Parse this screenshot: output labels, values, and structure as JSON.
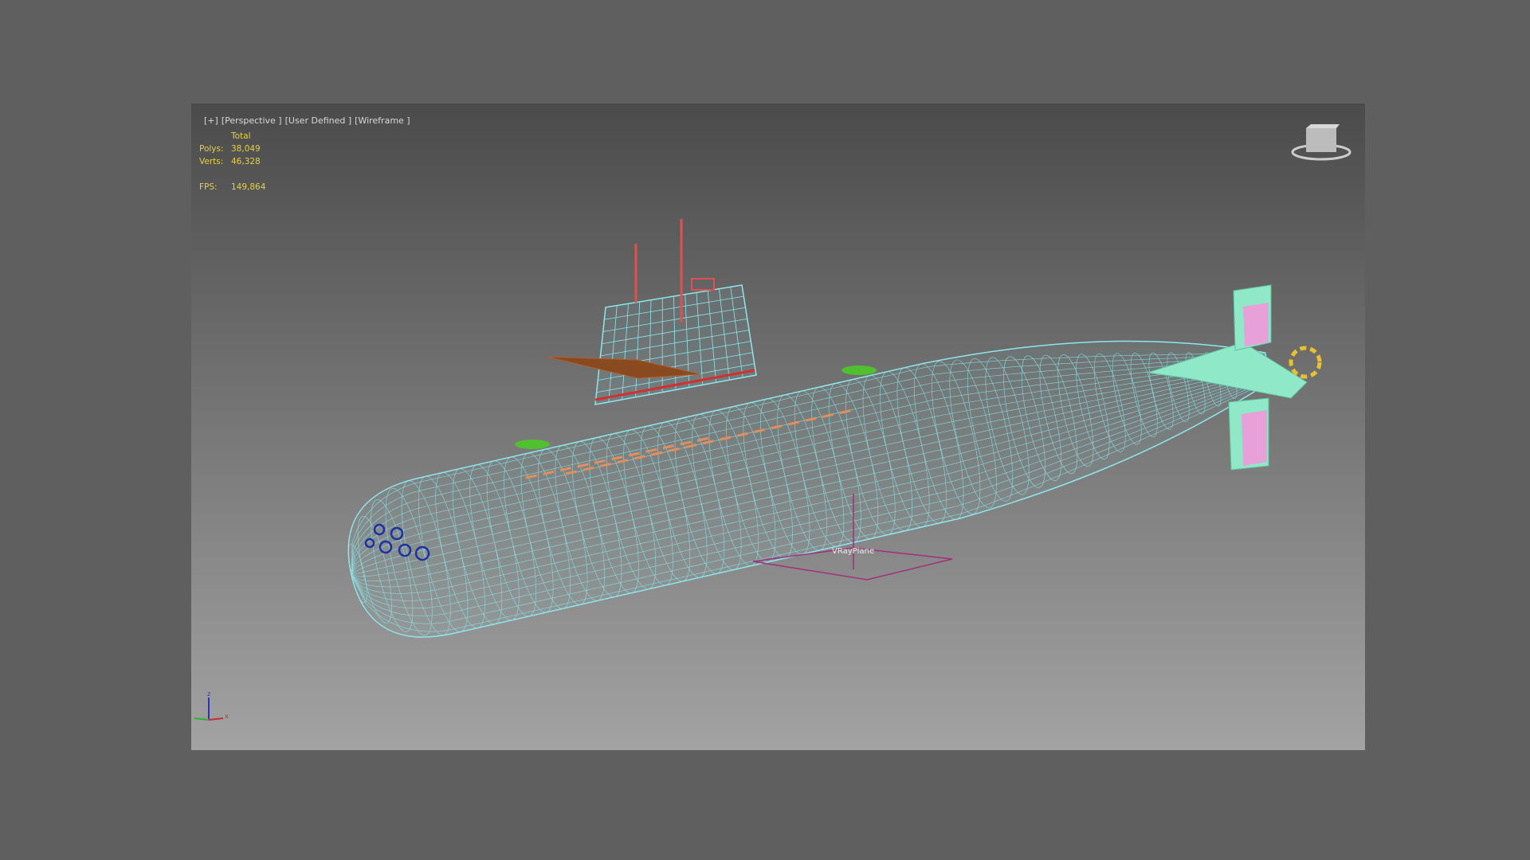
{
  "viewport": {
    "labels": [
      "[+]",
      "[Perspective ]",
      "[User Defined ]",
      "[Wireframe ]"
    ],
    "stats": {
      "header": "Total",
      "polys_label": "Polys:",
      "polys": "38,049",
      "verts_label": "Verts:",
      "verts": "46,328",
      "fps_label": "FPS:",
      "fps": "149,864"
    },
    "object_label": "VRayPlane",
    "colors": {
      "hull": "#8ee6ec",
      "mast": "#e05050",
      "plane": "#a0307a",
      "text": "#e8d040"
    }
  },
  "icons": [
    "viewcube-icon",
    "axis-tripod-icon"
  ]
}
